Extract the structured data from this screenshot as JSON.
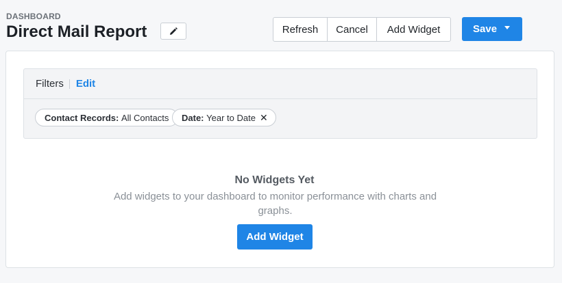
{
  "header": {
    "eyebrow": "DASHBOARD",
    "title": "Direct Mail Report",
    "edit_title_icon": "pencil-icon"
  },
  "toolbar": {
    "refresh_label": "Refresh",
    "cancel_label": "Cancel",
    "add_widget_label": "Add Widget",
    "save_label": "Save",
    "save_dropdown_icon": "caret-down-icon"
  },
  "filters": {
    "label": "Filters",
    "edit_label": "Edit",
    "chips": [
      {
        "key": "Contact Records:",
        "value": "All Contacts",
        "removable": false
      },
      {
        "key": "Date:",
        "value": "Year to Date",
        "removable": true,
        "remove_icon": "close-icon"
      }
    ]
  },
  "empty_state": {
    "title": "No Widgets Yet",
    "description": "Add widgets to your dashboard to monitor performance with charts and graphs.",
    "button_label": "Add Widget"
  },
  "colors": {
    "primary": "#1f85e6",
    "background": "#f6f7f9",
    "panel": "#ffffff",
    "border": "#c9ced4"
  }
}
